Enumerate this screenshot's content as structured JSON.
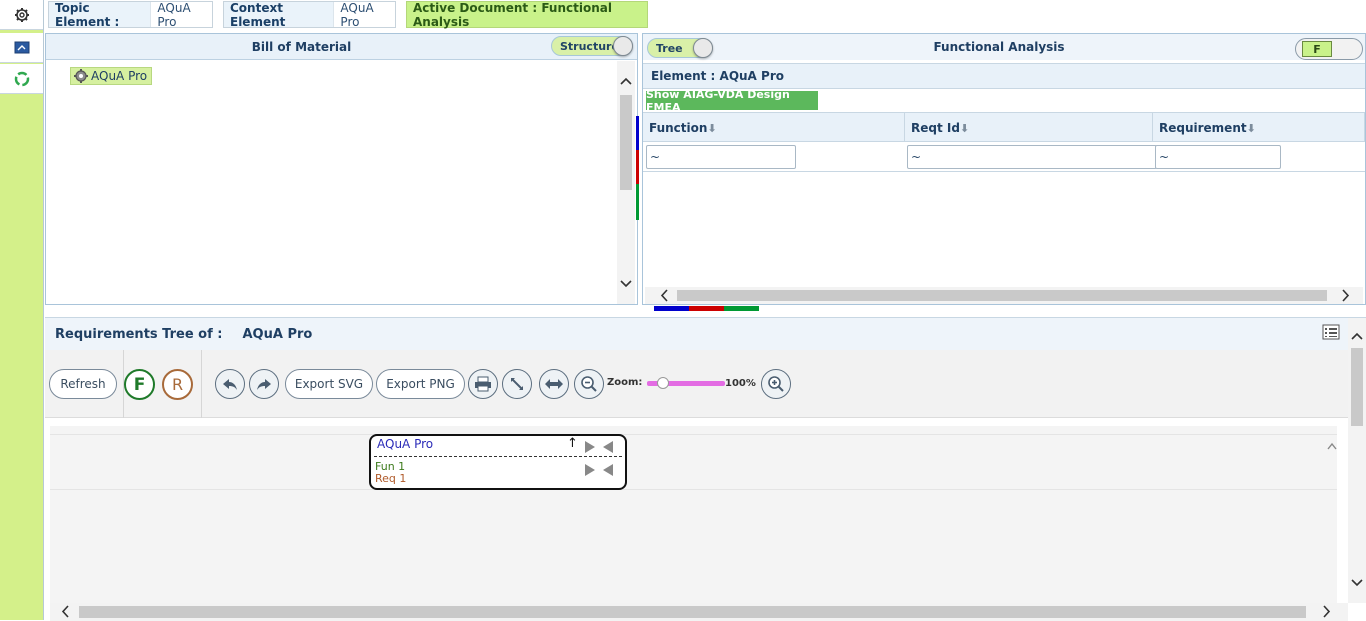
{
  "topbar": {
    "topic_label": "Topic Element :",
    "topic_value": "AQuA Pro",
    "context_label": "Context Element",
    "context_value": "AQuA Pro",
    "active_doc": "Active Document : Functional Analysis"
  },
  "bom": {
    "title": "Bill of Material",
    "toggle_label": "Structure",
    "tree_root": "AQuA Pro"
  },
  "fa": {
    "title": "Functional Analysis",
    "toggle_label": "Tree",
    "f_toggle_label": "F",
    "element_label": "Element : AQuA Pro",
    "show_button": "Show AIAG-VDA Design FMEA",
    "columns": [
      "Function",
      "Reqt Id",
      "Requirement"
    ],
    "filter_values": [
      "~",
      "~",
      "~"
    ]
  },
  "req_tree": {
    "title": "Requirements Tree of :",
    "element": "AQuA Pro",
    "toolbar": {
      "refresh": "Refresh",
      "f_label": "F",
      "r_label": "R",
      "export_svg": "Export SVG",
      "export_png": "Export PNG",
      "zoom_label": "Zoom:",
      "zoom_value": "100%",
      "zoom_level": 0.2
    },
    "node": {
      "title": "AQuA Pro",
      "function": "Fun 1",
      "requirement": "Req 1"
    }
  },
  "colors": {
    "green_accent": "#5cb85c",
    "rail_green": "#d4f08a",
    "blue": "#0000cc",
    "red": "#cc0000",
    "green": "#009933"
  }
}
